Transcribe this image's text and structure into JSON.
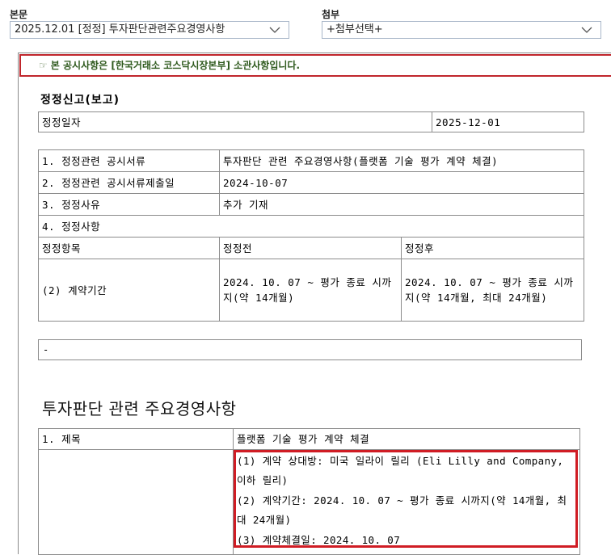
{
  "topbar": {
    "body_label": "본문",
    "body_select": "2025.12.01  [정정] 투자판단관련주요경영사항",
    "attach_label": "첨부",
    "attach_select": "+첨부선택+"
  },
  "notice": {
    "icon": "☞",
    "text": "본 공시사항은 [한국거래소 코스닥시장본부] 소관사항입니다."
  },
  "correction": {
    "title": "정정신고(보고)",
    "date_label": "정정일자",
    "date_value": "2025-12-01",
    "rows": [
      {
        "label": "1. 정정관련 공시서류",
        "value": "투자판단 관련 주요경영사항(플랫폼 기술 평가 계약 체결)"
      },
      {
        "label": "2. 정정관련 공시서류제출일",
        "value": "2024-10-07"
      },
      {
        "label": "3. 정정사유",
        "value": "추가 기재"
      }
    ],
    "item4_label": "4. 정정사항",
    "headers": {
      "item": "정정항목",
      "before": "정정전",
      "after": "정정후"
    },
    "change": {
      "item": "(2) 계약기간",
      "before": "2024. 10. 07 ~ 평가 종료 시까지(약 14개월)",
      "after": "2024. 10. 07 ~ 평가 종료 시까지(약 14개월, 최대 24개월)"
    },
    "remark": "-"
  },
  "main": {
    "title": "투자판단 관련 주요경영사항",
    "row1_label": "1. 제목",
    "row1_value": "플랫폼 기술 평가 계약 체결",
    "details": [
      "(1) 계약 상대방: 미국 일라이 릴리 (Eli Lilly and Company, 이하 릴리)",
      "(2) 계약기간: 2024. 10. 07 ~ 평가 종료 시까지(약 14개월, 최대 24개월)",
      "(3) 계약체결일: 2024. 10. 07"
    ]
  },
  "colors": {
    "notice_border": "#c0262c",
    "notice_text": "#2f5a1e",
    "highlight_border": "#d01c24"
  }
}
